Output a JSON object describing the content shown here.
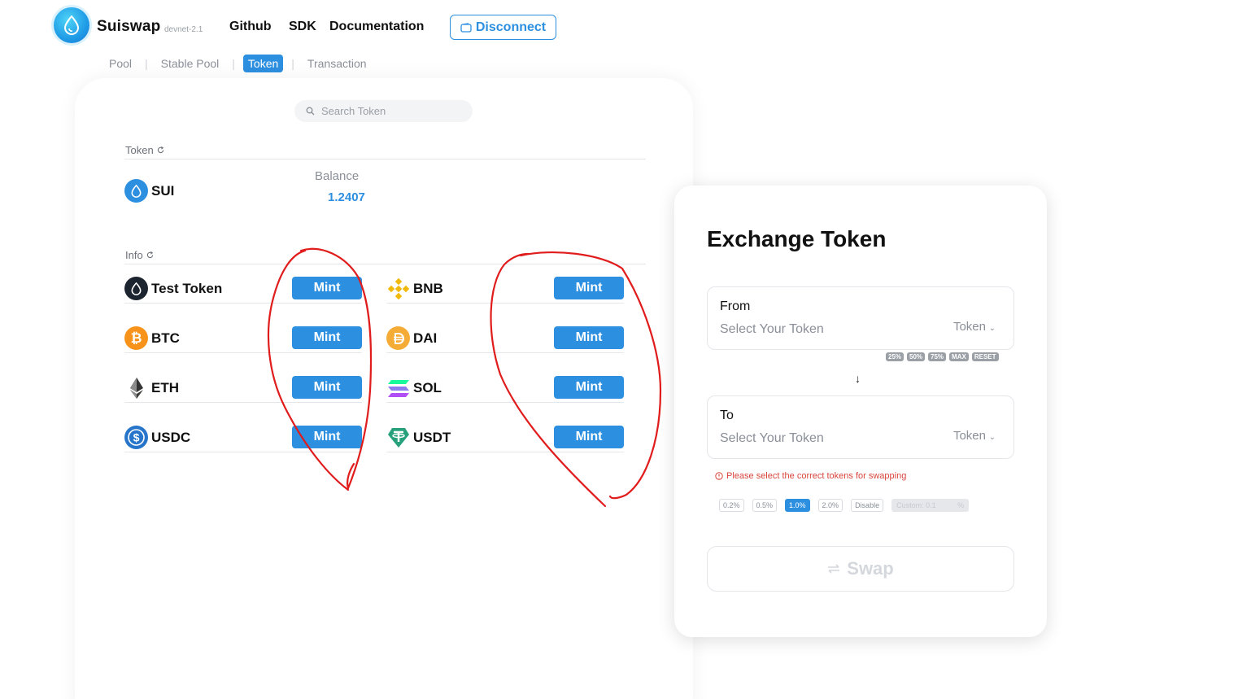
{
  "brand": {
    "name": "Suiswap",
    "version": "devnet-2.1"
  },
  "nav": {
    "github": "Github",
    "sdk": "SDK",
    "docs": "Documentation",
    "disconnect": "Disconnect"
  },
  "tabs": [
    {
      "label": "Pool",
      "active": false
    },
    {
      "label": "Stable Pool",
      "active": false
    },
    {
      "label": "Token",
      "active": true
    },
    {
      "label": "Transaction",
      "active": false
    }
  ],
  "search": {
    "placeholder": "Search Token"
  },
  "token_section": {
    "label": "Token",
    "sui_name": "SUI",
    "balance_label": "Balance",
    "balance_value": "1.2407"
  },
  "info_section": {
    "label": "Info",
    "mint_label": "Mint",
    "tokens": [
      {
        "name": "Test Token",
        "icon": "test-token-icon"
      },
      {
        "name": "BNB",
        "icon": "bnb-icon"
      },
      {
        "name": "BTC",
        "icon": "btc-icon"
      },
      {
        "name": "DAI",
        "icon": "dai-icon"
      },
      {
        "name": "ETH",
        "icon": "eth-icon"
      },
      {
        "name": "SOL",
        "icon": "sol-icon"
      },
      {
        "name": "USDC",
        "icon": "usdc-icon"
      },
      {
        "name": "USDT",
        "icon": "usdt-icon"
      }
    ]
  },
  "exchange": {
    "title": "Exchange Token",
    "from_label": "From",
    "to_label": "To",
    "select_placeholder": "Select Your Token",
    "token_dropdown": "Token",
    "percent_buttons": [
      "25%",
      "50%",
      "75%",
      "MAX",
      "RESET"
    ],
    "warning": "Please select the correct tokens for swapping",
    "slippage": [
      "0.2%",
      "0.5%",
      "1.0%",
      "2.0%",
      "Disable"
    ],
    "slippage_active": "1.0%",
    "custom_label": "Custom:",
    "custom_value": "0.1",
    "custom_unit": "%",
    "swap_label": "Swap"
  },
  "colors": {
    "accent": "#2d8fe0",
    "warning": "#d9443c",
    "annotation": "#e01c1c"
  }
}
